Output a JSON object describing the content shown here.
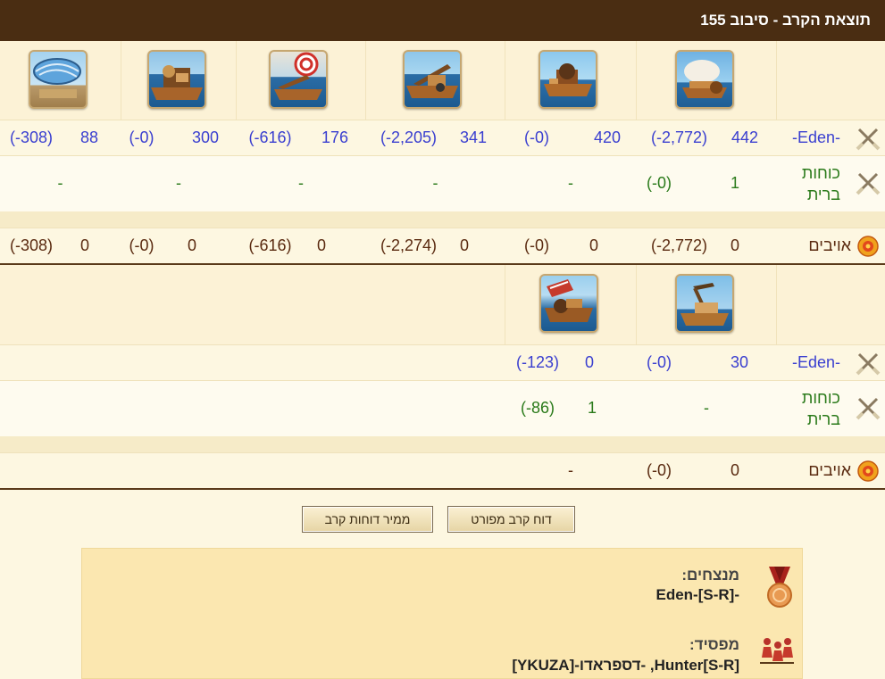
{
  "header": {
    "title": "תוצאת הקרב - סיבוב 155"
  },
  "round1": {
    "attacker_label": "-Eden-",
    "ally_label_1": "כוחות",
    "ally_label_2": "ברית",
    "enemy_label": "אויבים",
    "units": [
      {
        "icon": "paddle-steamer-icon",
        "count": "442",
        "loss": "(-2,772)",
        "ally_count": "1",
        "ally_loss": "(-0)",
        "enemy_count": "0",
        "enemy_loss": "(-2,772)"
      },
      {
        "icon": "mortar-ship-icon",
        "count": "420",
        "loss": "(-0)",
        "ally": "-",
        "enemy_count": "0",
        "enemy_loss": "(-0)"
      },
      {
        "icon": "catapult-ship-icon",
        "count": "341",
        "loss": "(-2,205)",
        "ally": "-",
        "enemy_count": "0",
        "enemy_loss": "(-2,274)"
      },
      {
        "icon": "fire-ship-icon",
        "count": "176",
        "loss": "(-616)",
        "ally": "-",
        "enemy_count": "0",
        "enemy_loss": "(-616)"
      },
      {
        "icon": "ballista-ship-icon",
        "count": "300",
        "loss": "(-0)",
        "ally": "-",
        "enemy_count": "0",
        "enemy_loss": "(-0)"
      },
      {
        "icon": "balloon-carrier-icon",
        "count": "88",
        "loss": "(-308)",
        "ally": "-",
        "enemy_count": "0",
        "enemy_loss": "(-308)"
      }
    ]
  },
  "round2": {
    "attacker_label": "-Eden-",
    "ally_label_1": "כוחות",
    "ally_label_2": "ברית",
    "enemy_label": "אויבים",
    "units": [
      {
        "icon": "crane-ship-icon",
        "count": "30",
        "loss": "(-0)",
        "ally": "-",
        "enemy_count": "0",
        "enemy_loss": "(-0)"
      },
      {
        "icon": "tender-ship-icon",
        "count": "0",
        "loss": "(-123)",
        "ally_count": "1",
        "ally_loss": "(-86)",
        "enemy": "-"
      }
    ]
  },
  "buttons": {
    "detailed_report": "דוח קרב מפורט",
    "convert_reports": "ממיר דוחות קרב"
  },
  "result": {
    "winners_title": "מנצחים:",
    "winners_value": "-Eden-[S-R]",
    "loser_title": "מפסיד:",
    "loser_value": "Hunter[S-R], -דספראדו-[YKUZA]"
  },
  "colors": {
    "header_bg": "#4a2d12",
    "page_bg": "#fdf7e1",
    "blue_text": "#3a3fd0",
    "green_text": "#2a7a1a",
    "enemy_text": "#5a2a10",
    "result_bg": "#fbe7b0"
  }
}
